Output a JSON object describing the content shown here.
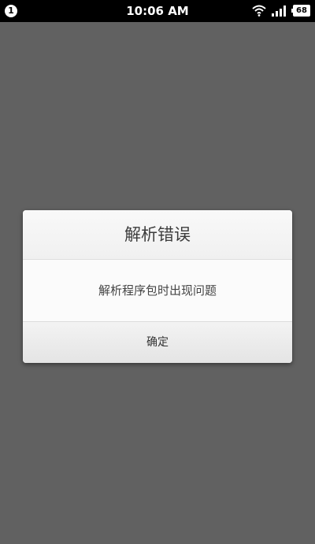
{
  "status_bar": {
    "notification_count": "1",
    "time": "10:06 AM",
    "battery_level": "68",
    "icons": [
      "wifi-icon",
      "signal-icon",
      "battery-icon"
    ]
  },
  "dialog": {
    "title": "解析错误",
    "message": "解析程序包时出现问题",
    "confirm_label": "确定"
  },
  "colors": {
    "backdrop": "#616161",
    "status_bar": "#000000",
    "dialog_background": "#f8f8f8"
  }
}
